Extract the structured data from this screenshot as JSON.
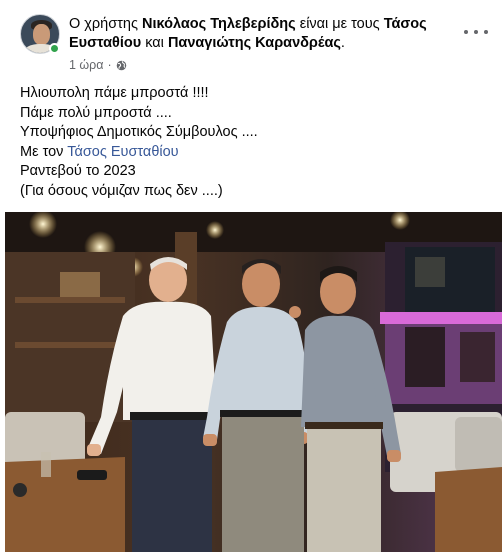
{
  "header": {
    "prefix": "Ο χρήστης",
    "author": "Νικόλαος Τηλεβερίδης",
    "with_text": "είναι με τους",
    "tagged_1": "Τάσος Ευσταθίου",
    "and_text": "και",
    "tagged_2": "Παναγιώτης Καρανδρέας",
    "end": ".",
    "time": "1 ώρα",
    "separator": "·",
    "privacy_icon": "globe-icon",
    "more_icon": "more-options-icon"
  },
  "post": {
    "lines": [
      "Ηλιουπολη πάμε μπροστά !!!!",
      "Πάμε πολύ μπροστά ....",
      "Υποψήφιος Δημοτικός Σύμβουλος ....",
      "Με τον ",
      "Ραντεβού το 2023",
      "(Για όσους νόμιζαν πως δεν ....)"
    ],
    "mention": "Τάσος Ευσταθίου"
  },
  "colors": {
    "text": "#050505",
    "meta": "#65676b",
    "mention": "#385898",
    "online": "#31a24c"
  }
}
